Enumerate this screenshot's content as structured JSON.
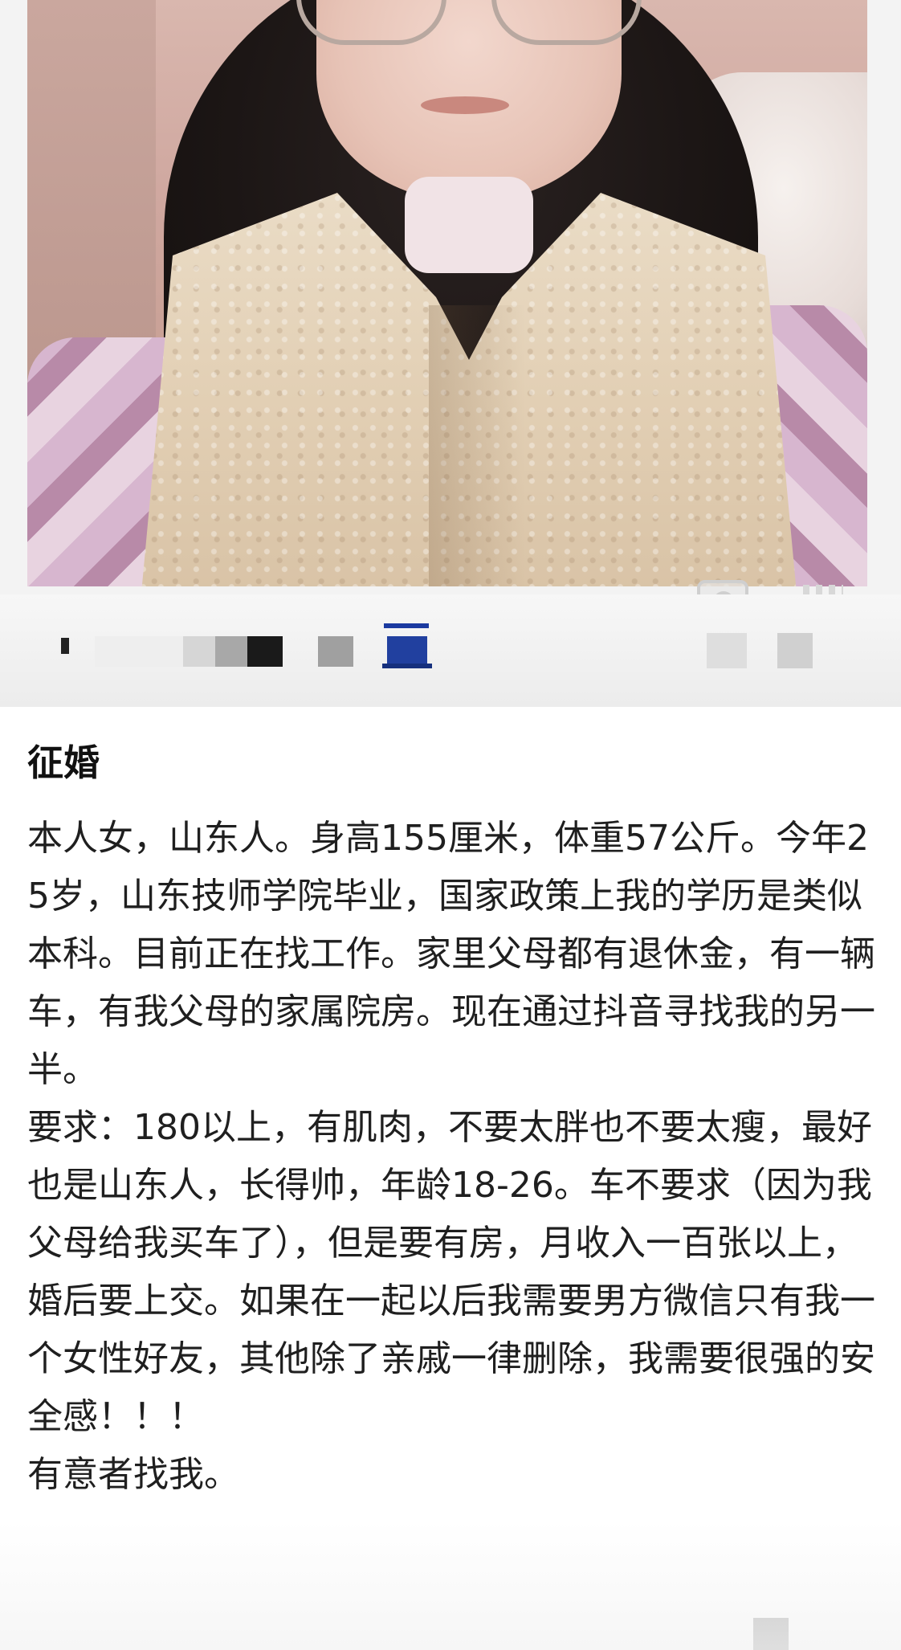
{
  "post": {
    "title": "征婚",
    "paragraphs": [
      "本人女，山东人。身高155厘米，体重57公斤。今年25岁，山东技师学院毕业，国家政策上我的学历是类似本科。目前正在找工作。家里父母都有退休金，有一辆车，有我父母的家属院房。现在通过抖音寻找我的另一半。",
      "要求：180以上，有肌肉，不要太胖也不要太瘦，最好也是山东人，长得帅，年龄18-26。车不要求（因为我父母给我买车了），但是要有房，月收入一百张以上，婚后要上交。如果在一起以后我需要男方微信只有我一个女性好友，其他除了亲戚一律删除，我需要很强的安全感！！！",
      "有意者找我。"
    ]
  },
  "photo": {
    "icon": "person-photo",
    "overlay_icons": [
      "camera-icon",
      "menu-icon"
    ]
  },
  "watermark": {
    "state": "blurred-username"
  }
}
